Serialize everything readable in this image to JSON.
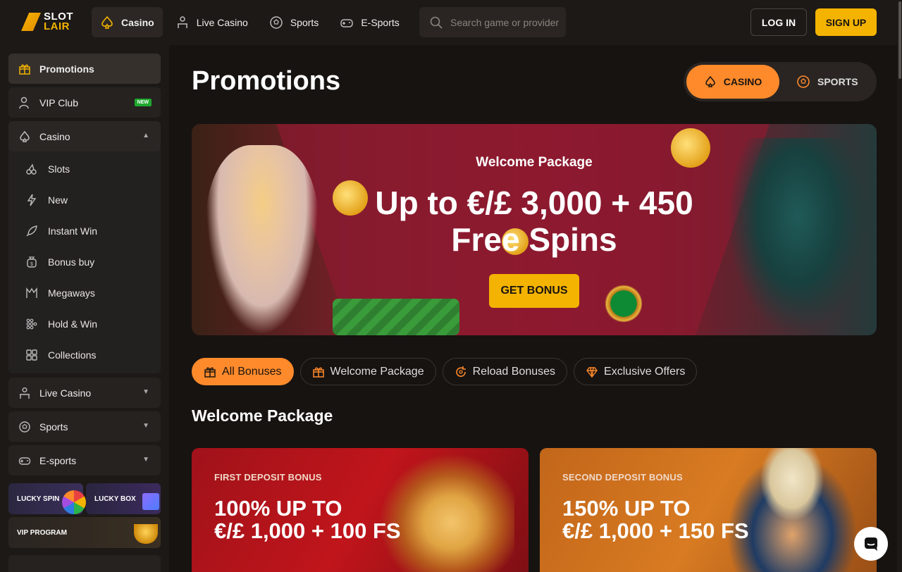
{
  "brand": {
    "line1": "SLOT",
    "line2": "LAIR"
  },
  "nav": {
    "casino": "Casino",
    "live_casino": "Live Casino",
    "sports": "Sports",
    "esports": "E-Sports"
  },
  "search": {
    "placeholder": "Search game or provider"
  },
  "auth": {
    "login": "LOG IN",
    "signup": "SIGN UP"
  },
  "sidebar": {
    "promotions": "Promotions",
    "vip_club": "VIP Club",
    "new_badge": "NEW",
    "casino": "Casino",
    "sub": [
      "Slots",
      "New",
      "Instant Win",
      "Bonus buy",
      "Megaways",
      "Hold & Win",
      "Collections"
    ],
    "live_casino": "Live Casino",
    "sports": "Sports",
    "esports": "E-sports",
    "lucky_spin": "LUCKY SPIN",
    "lucky_box": "LUCKY BOX",
    "vip_program": "VIP PROGRAM"
  },
  "main": {
    "title": "Promotions",
    "toggle": {
      "casino": "CASINO",
      "sports": "SPORTS"
    },
    "hero": {
      "subtitle": "Welcome Package",
      "headline_1": "Up to €/£ 3,000 + 450",
      "headline_2": "Free Spins",
      "cta": "GET BONUS"
    },
    "filters": [
      "All Bonuses",
      "Welcome Package",
      "Reload Bonuses",
      "Exclusive Offers"
    ],
    "section_title": "Welcome Package",
    "cards": [
      {
        "label": "FIRST DEPOSIT BONUS",
        "line1": "100% UP TO",
        "line2": "€/£ 1,000 + 100 FS"
      },
      {
        "label": "SECOND DEPOSIT BONUS",
        "line1": "150% UP TO",
        "line2": "€/£ 1,000 + 150 FS"
      }
    ]
  },
  "colors": {
    "accent_orange": "#ff8a2b",
    "accent_yellow": "#f3b300",
    "bg": "#171311",
    "new_badge": "#1fa82f"
  }
}
